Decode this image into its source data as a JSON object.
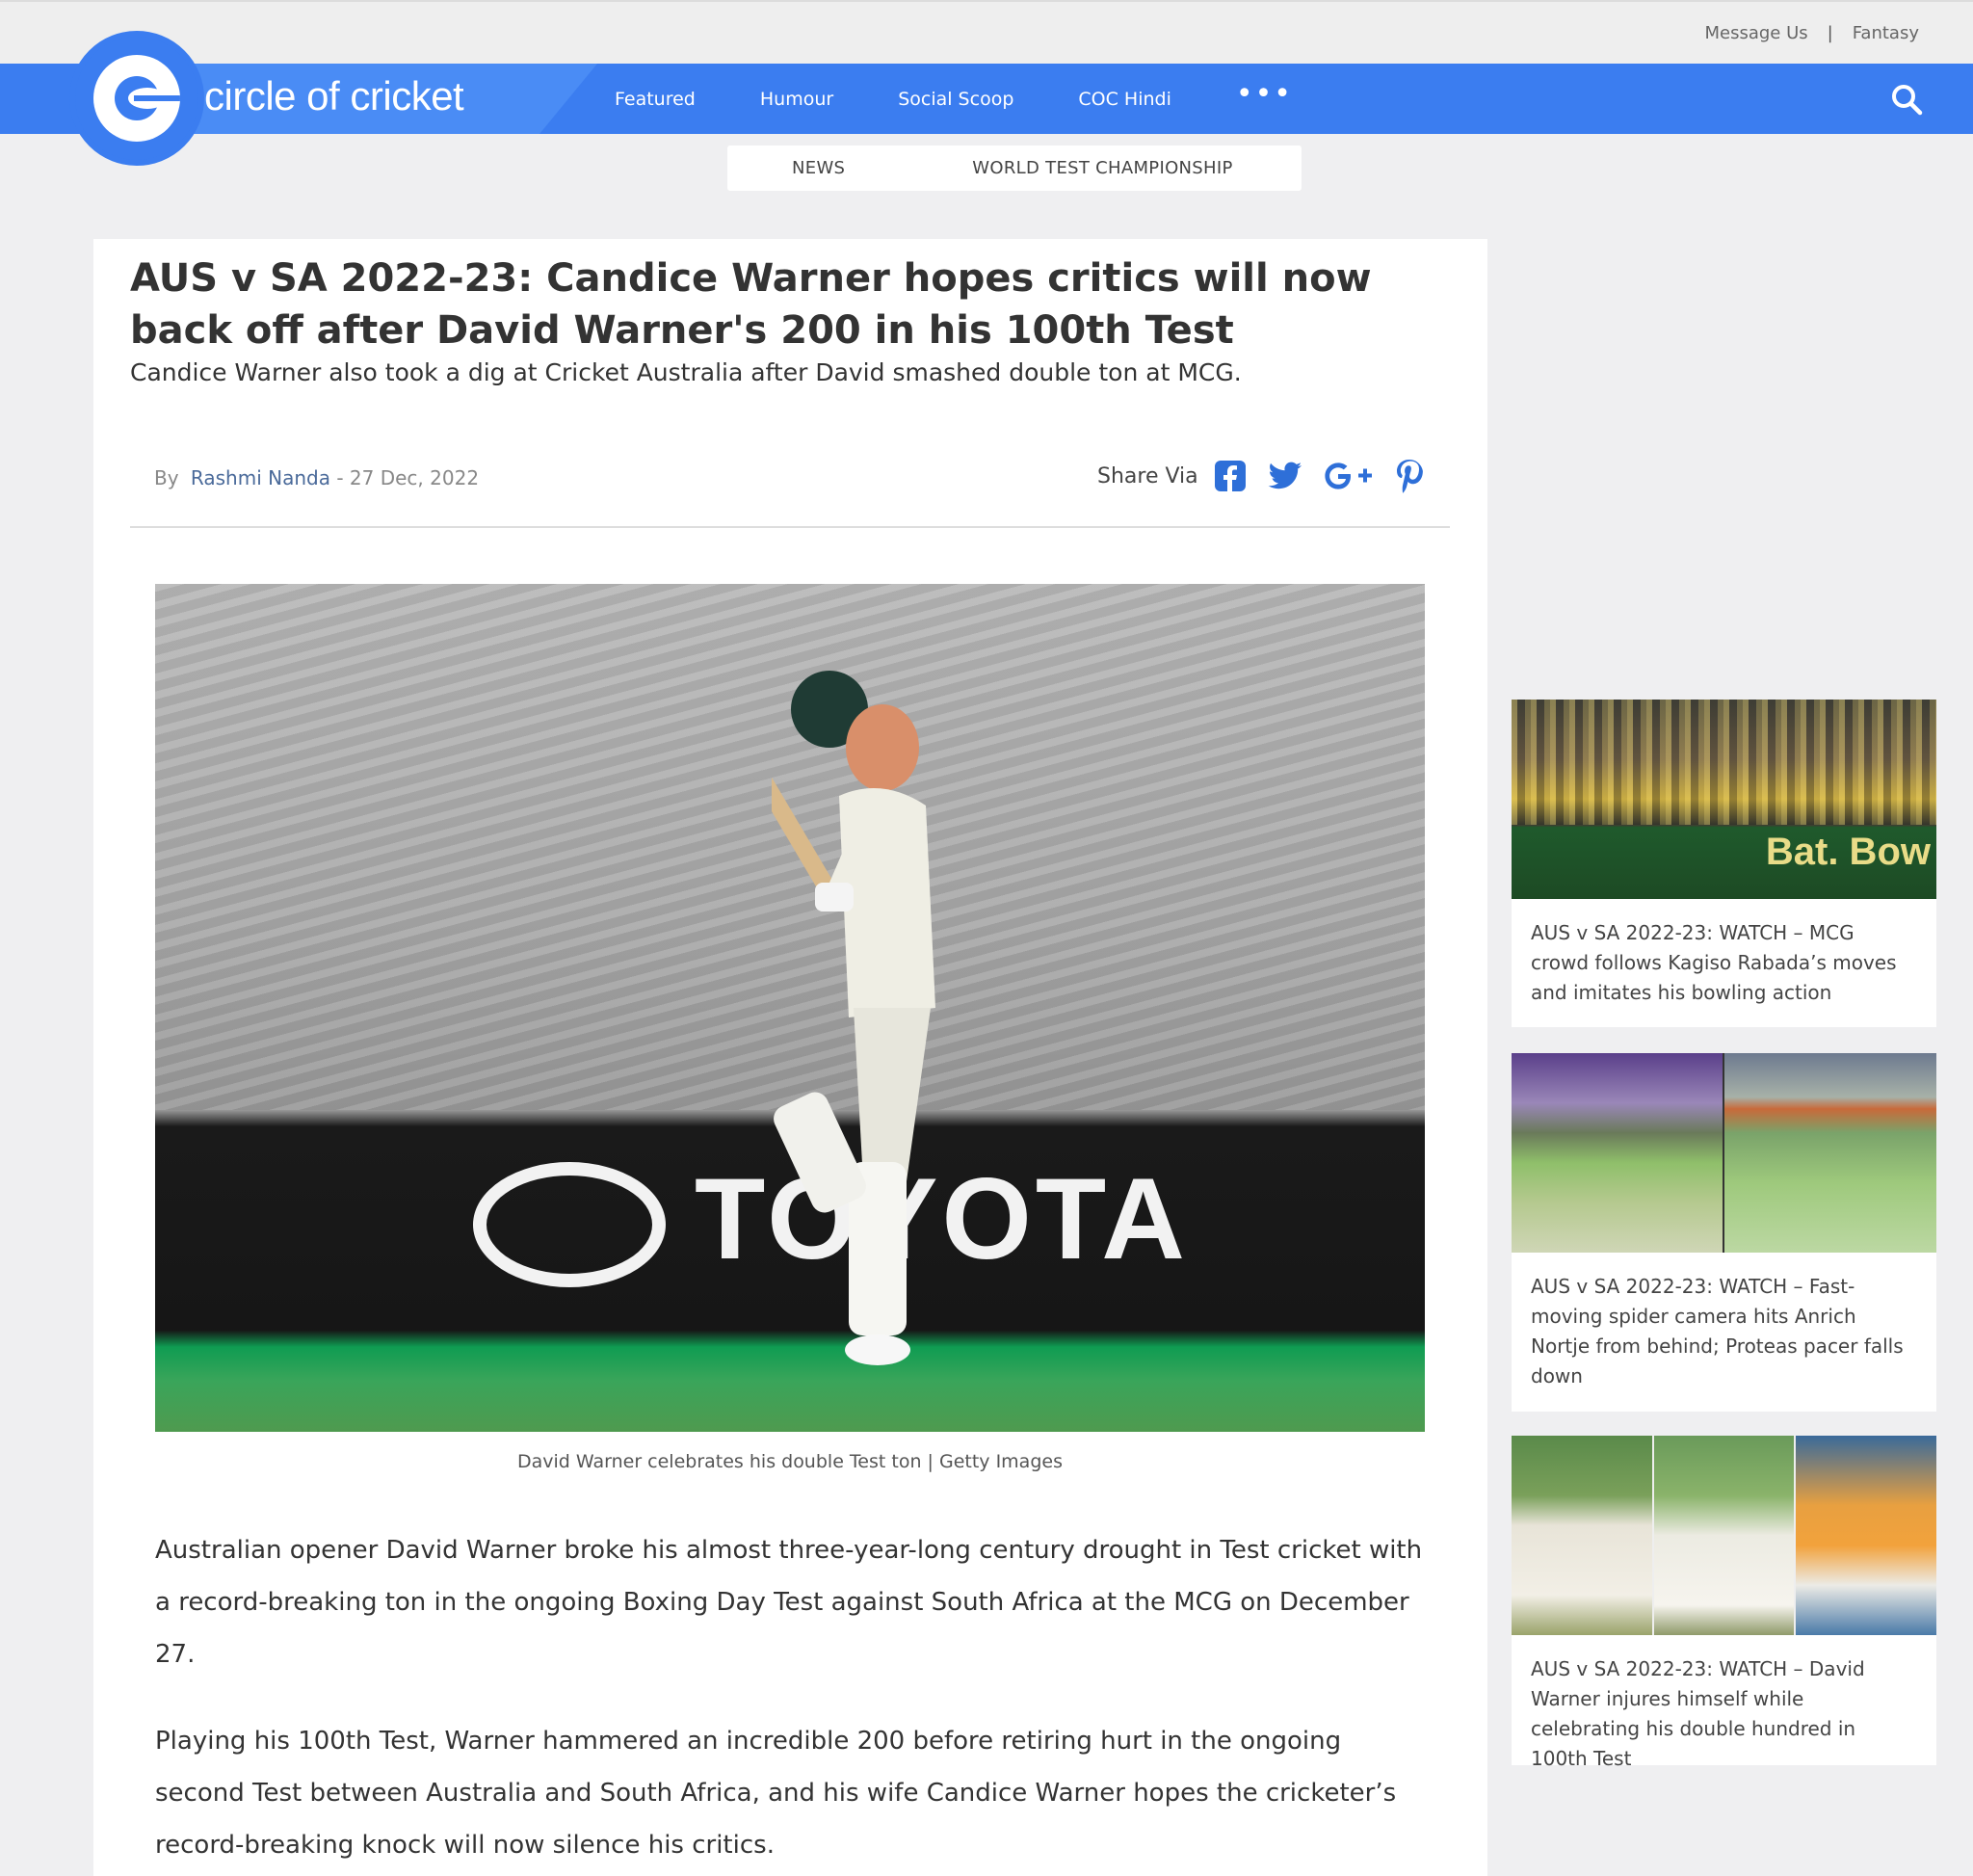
{
  "top_links": [
    "Message Us",
    "Fantasy"
  ],
  "brand": {
    "name": "circle of cricket",
    "color": "#3b7df0"
  },
  "nav": {
    "items": [
      "Featured",
      "Humour",
      "Social Scoop",
      "COC Hindi"
    ],
    "more": "•••"
  },
  "categories": [
    "NEWS",
    "WORLD TEST CHAMPIONSHIP"
  ],
  "article": {
    "headline": "AUS v SA 2022-23: Candice Warner hopes critics will now back off after David Warner's 200 in his 100th Test",
    "subheadline": "Candice Warner also took a dig at Cricket Australia after David smashed double ton at MCG.",
    "by_label": "By",
    "author": "Rashmi Nanda",
    "date": "- 27 Dec, 2022",
    "share_label": "Share Via",
    "share_icons": [
      "facebook-icon",
      "twitter-icon",
      "google-plus-icon",
      "pinterest-icon"
    ],
    "photo_sponsor_text": "TOYOTA",
    "caption": "David Warner celebrates his double Test ton | Getty Images",
    "paragraphs": [
      "Australian opener David Warner broke his almost three-year-long century drought in Test cricket with a record-breaking ton in the ongoing Boxing Day Test against South Africa at the MCG on December 27.",
      "Playing his 100th Test, Warner hammered an incredible 200 before retiring hurt in the ongoing second Test between Australia and South Africa, and his wife Candice Warner hopes the cricketer’s record-breaking knock will now silence his critics."
    ]
  },
  "sidebar": {
    "cards": [
      {
        "title": "AUS v SA 2022-23: WATCH – MCG crowd follows Kagiso Rabada’s moves and imitates his bowling action",
        "image_text": "Bat. Bow"
      },
      {
        "title": "AUS v SA 2022-23: WATCH – Fast-moving spider camera hits Anrich Nortje from behind; Proteas pacer falls down"
      },
      {
        "title": "AUS v SA 2022-23: WATCH – David Warner injures himself while celebrating his double hundred in 100th Test"
      }
    ]
  }
}
